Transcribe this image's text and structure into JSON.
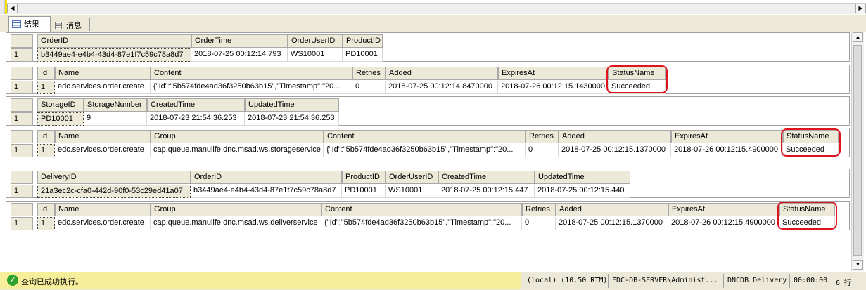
{
  "tabs": {
    "results": "结果",
    "messages": "消息"
  },
  "grids": [
    {
      "cols": [
        {
          "h": "OrderID",
          "v": "b3449ae4-e4b4-43d4-87e1f7c59c78a8d7",
          "sel": true
        },
        {
          "h": "OrderTime",
          "v": "2018-07-25 00:12:14.793"
        },
        {
          "h": "OrderUserID",
          "v": "WS10001"
        },
        {
          "h": "ProductID",
          "v": "PD10001"
        }
      ],
      "rownum": "1"
    },
    {
      "cols": [
        {
          "h": "Id",
          "v": "1",
          "sel": true
        },
        {
          "h": "Name",
          "v": "edc.services.order.create"
        },
        {
          "h": "Content",
          "v": "{\"Id\":\"5b574fde4ad36f3250b63b15\",\"Timestamp\":\"20..."
        },
        {
          "h": "Retries",
          "v": "0"
        },
        {
          "h": "Added",
          "v": "2018-07-25 00:12:14.8470000"
        },
        {
          "h": "ExpiresAt",
          "v": "2018-07-26 00:12:15.1430000"
        },
        {
          "h": "StatusName",
          "v": "Succeeded"
        }
      ],
      "rownum": "1"
    },
    {
      "cols": [
        {
          "h": "StorageID",
          "v": "PD10001",
          "sel": true
        },
        {
          "h": "StorageNumber",
          "v": "9"
        },
        {
          "h": "CreatedTime",
          "v": "2018-07-23 21:54:36.253"
        },
        {
          "h": "UpdatedTime",
          "v": "2018-07-23 21:54:36.253"
        }
      ],
      "rownum": "1"
    },
    {
      "cols": [
        {
          "h": "Id",
          "v": "1",
          "sel": true
        },
        {
          "h": "Name",
          "v": "edc.services.order.create"
        },
        {
          "h": "Group",
          "v": "cap.queue.manulife.dnc.msad.ws.storageservice"
        },
        {
          "h": "Content",
          "v": "{\"Id\":\"5b574fde4ad36f3250b63b15\",\"Timestamp\":\"20..."
        },
        {
          "h": "Retries",
          "v": "0"
        },
        {
          "h": "Added",
          "v": "2018-07-25 00:12:15.1370000"
        },
        {
          "h": "ExpiresAt",
          "v": "2018-07-26 00:12:15.4900000"
        },
        {
          "h": "StatusName",
          "v": "Succeeded"
        }
      ],
      "rownum": "1"
    },
    {
      "cols": [
        {
          "h": "DeliveryID",
          "v": "21a3ec2c-cfa0-442d-90f0-53c29ed41a07",
          "sel": true
        },
        {
          "h": "OrderID",
          "v": "b3449ae4-e4b4-43d4-87e1f7c59c78a8d7"
        },
        {
          "h": "ProductID",
          "v": "PD10001"
        },
        {
          "h": "OrderUserID",
          "v": "WS10001"
        },
        {
          "h": "CreatedTime",
          "v": "2018-07-25 00:12:15.447"
        },
        {
          "h": "UpdatedTime",
          "v": "2018-07-25 00:12:15.440"
        }
      ],
      "rownum": "1"
    },
    {
      "cols": [
        {
          "h": "Id",
          "v": "1",
          "sel": true
        },
        {
          "h": "Name",
          "v": "edc.services.order.create"
        },
        {
          "h": "Group",
          "v": "cap.queue.manulife.dnc.msad.ws.deliverservice"
        },
        {
          "h": "Content",
          "v": "{\"Id\":\"5b574fde4ad36f3250b63b15\",\"Timestamp\":\"20..."
        },
        {
          "h": "Retries",
          "v": "0"
        },
        {
          "h": "Added",
          "v": "2018-07-25 00:12:15.1370000"
        },
        {
          "h": "ExpiresAt",
          "v": "2018-07-26 00:12:15.4900000"
        },
        {
          "h": "StatusName",
          "v": "Succeeded"
        }
      ],
      "rownum": "1"
    }
  ],
  "status": {
    "message": "查询已成功执行。",
    "server": "(local) (10.50 RTM)",
    "user": "EDC-DB-SERVER\\Administ...",
    "database": "DNCDB_Delivery",
    "elapsed": "00:00:00",
    "rows": "6 行"
  },
  "colors": {
    "highlight": "#e0141e",
    "status_bg": "#f6ee9a",
    "header_bg": "#ece9d8"
  }
}
